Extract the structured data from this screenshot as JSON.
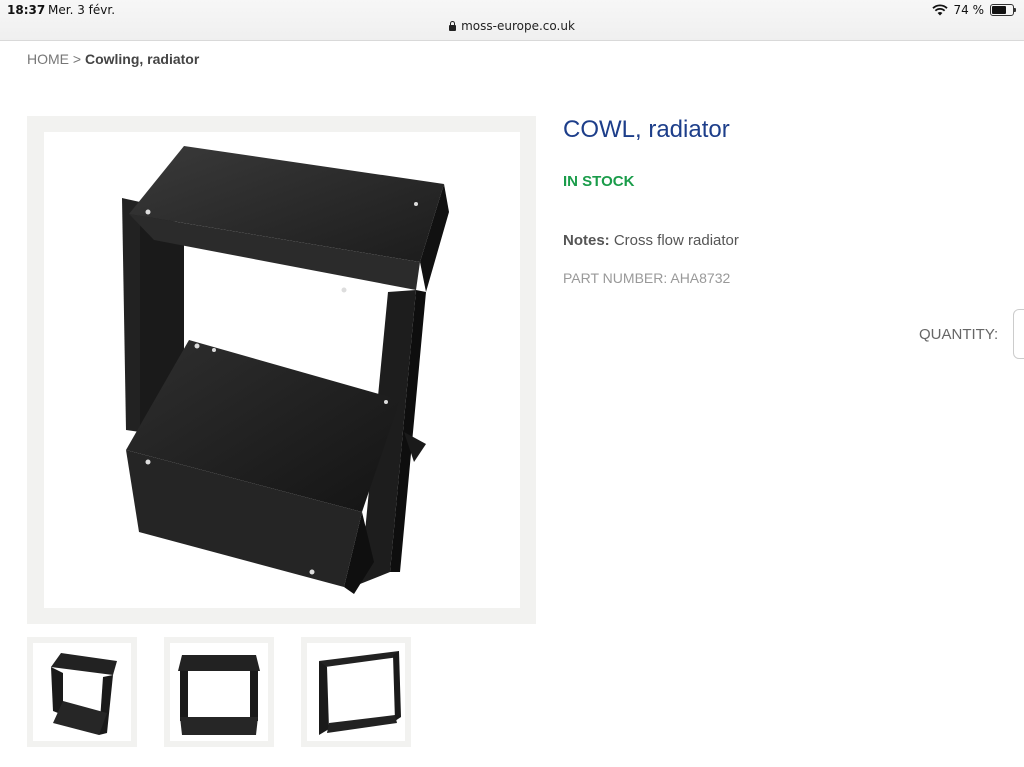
{
  "statusbar": {
    "time": "18:37",
    "date": "Mer. 3 févr.",
    "battery": "74 %",
    "battery_level": 0.74,
    "url": "moss-europe.co.uk"
  },
  "breadcrumb": {
    "home": "HOME",
    "separator": ">",
    "current": "Cowling, radiator"
  },
  "product": {
    "title": "COWL, radiator",
    "stock": "IN STOCK",
    "notes_label": "Notes:",
    "notes_value": "Cross flow radiator",
    "part_number": "PART NUMBER: AHA8732",
    "quantity_label": "QUANTITY:"
  },
  "colors": {
    "title": "#1d3e8a",
    "in_stock": "#1a9c4a",
    "part": "#1a1a1a"
  },
  "icons": [
    "lock-icon",
    "wifi-icon",
    "battery-icon"
  ]
}
